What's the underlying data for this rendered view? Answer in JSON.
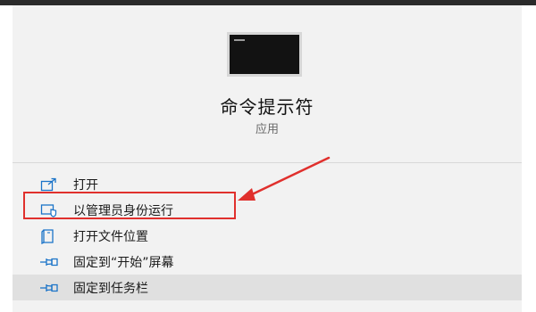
{
  "app": {
    "title": "命令提示符",
    "subtitle": "应用",
    "icon": "command-prompt-icon"
  },
  "menu": {
    "items": [
      {
        "label": "打开",
        "icon": "open-icon"
      },
      {
        "label": "以管理员身份运行",
        "icon": "run-as-admin-icon",
        "highlighted": true
      },
      {
        "label": "打开文件位置",
        "icon": "file-location-icon"
      },
      {
        "label": "固定到“开始”屏幕",
        "icon": "pin-icon"
      },
      {
        "label": "固定到任务栏",
        "icon": "pin-icon",
        "hovered": true
      }
    ]
  },
  "colors": {
    "accent": "#1a73c8",
    "annotation": "#e0302d",
    "panel_bg": "#f2f2f2",
    "hover_bg": "#e0e0e0"
  }
}
